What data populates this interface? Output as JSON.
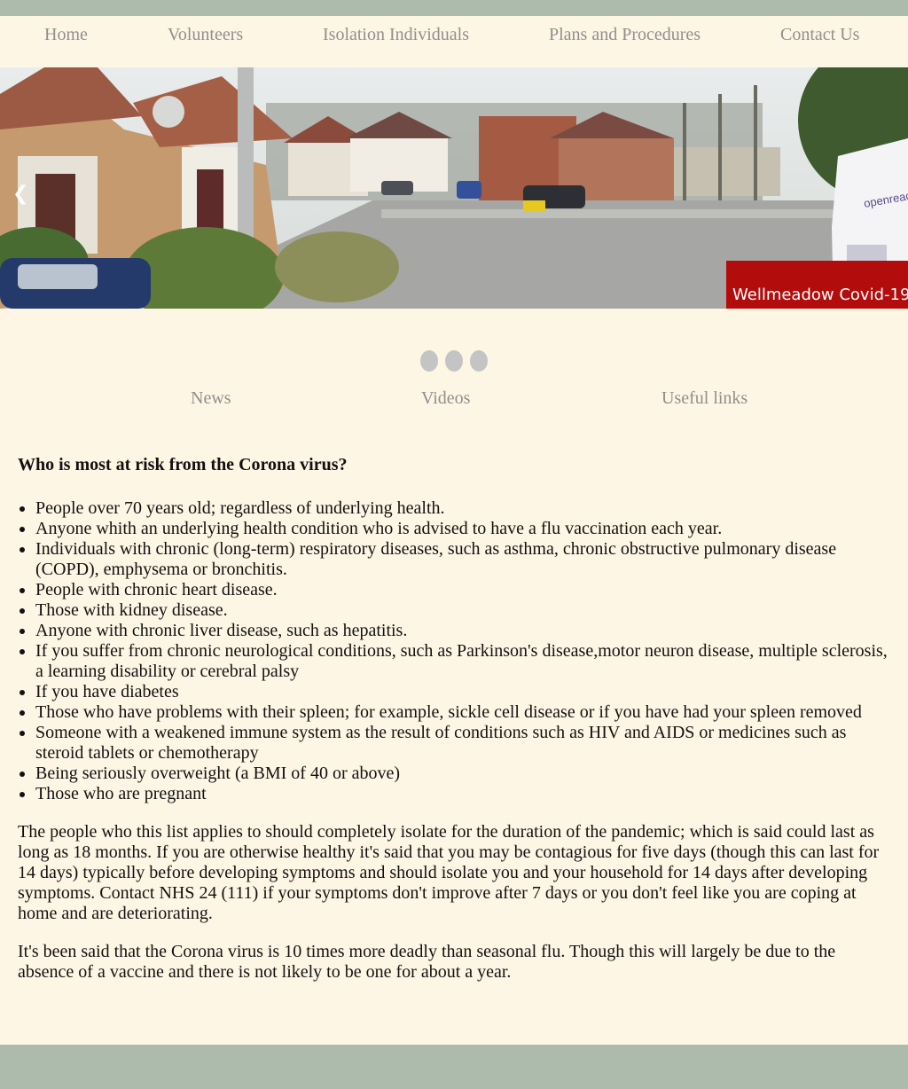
{
  "nav": {
    "items": [
      "Home",
      "Volunteers",
      "Isolation Individuals",
      "Plans and Procedures",
      "Contact Us"
    ]
  },
  "hero": {
    "prev_icon": "❮",
    "caption": "Wellmeadow Covid-19",
    "van_text": "openreach"
  },
  "slider": {
    "dot_count": 3
  },
  "subnav": {
    "items": [
      "News",
      "Videos",
      "Useful links"
    ]
  },
  "article": {
    "heading": "Who is most at risk from the Corona virus?",
    "list": [
      "People over 70 years old; regardless of underlying health.",
      "Anyone whith an underlying health condition who is advised to have a flu vaccination each year.",
      "Individuals with chronic (long-term) respiratory diseases, such as asthma, chronic obstructive pulmonary disease (COPD), emphysema or bronchitis.",
      "People with chronic heart disease.",
      "Those with kidney disease.",
      "Anyone with chronic liver disease, such as hepatitis.",
      "If you suffer from chronic neurological conditions, such as Parkinson's disease,motor neuron disease, multiple sclerosis, a learning disability or cerebral palsy",
      "If you have diabetes",
      "Those who have problems with their spleen; for example, sickle cell disease or if you have had your spleen removed",
      "Someone with a weakened immune system as the result of conditions such as HIV and AIDS or medicines such as steroid tablets or chemotherapy",
      "Being seriously overweight (a BMI of 40 or above)",
      "Those who are pregnant"
    ],
    "para1": "The people who this list applies to should completely isolate for the duration of the pandemic; which is said could last as long as 18 months. If you are otherwise healthy it's said that you may be contagious for five days (though this can last for 14 days) typically before developing symptoms and should isolate you and your household for 14 days after developing symptoms. Contact NHS 24 (111) if your symptoms don't improve after 7 days or you don't feel like you are coping at home and are deteriorating.",
    "para2": "It's been said that the Corona virus is 10 times more deadly than seasonal flu. Though this will largely be due to the absence of a vaccine and there is not likely to be one for about a year."
  }
}
